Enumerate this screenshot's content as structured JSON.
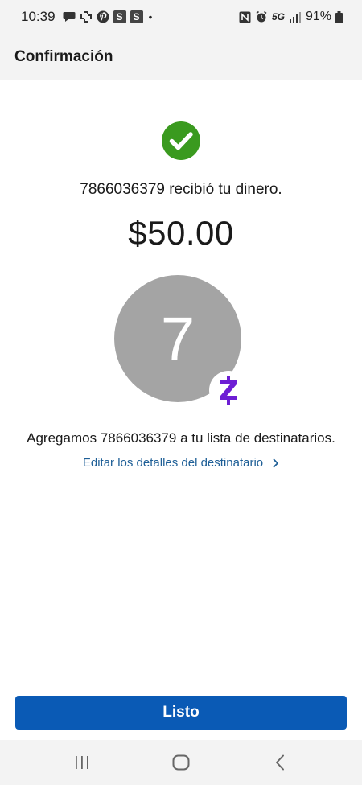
{
  "status_bar": {
    "time": "10:39",
    "s_icon_1": "S",
    "s_icon_2": "S",
    "dot": "•",
    "network": "5G",
    "battery": "91%"
  },
  "header": {
    "title": "Confirmación"
  },
  "confirmation": {
    "received_text": "7866036379 recibió tu dinero.",
    "amount": "$50.00",
    "avatar_initial": "7",
    "added_text": "Agregamos 7866036379 a tu lista de destinatarios.",
    "edit_link": "Editar los detalles del destinatario"
  },
  "footer": {
    "done_label": "Listo"
  },
  "colors": {
    "success_green": "#3a9a1f",
    "zelle_purple": "#6d1ed4",
    "button_blue": "#0a5ab5",
    "link_blue": "#1d5e96",
    "avatar_gray": "#a4a4a4"
  },
  "icons": {
    "success": "check-circle-icon",
    "brand_badge": "zelle-icon",
    "chevron": "chevron-right-icon",
    "nav_recents": "recents-icon",
    "nav_home": "home-icon",
    "nav_back": "back-icon"
  }
}
